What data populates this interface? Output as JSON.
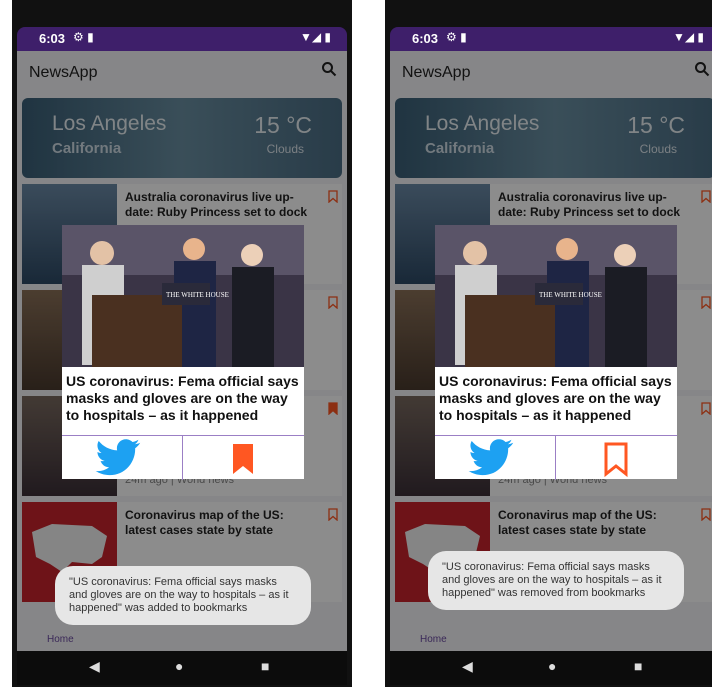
{
  "status": {
    "time": "6:03"
  },
  "app": {
    "title": "NewsApp"
  },
  "weather": {
    "city": "Los Angeles",
    "region": "California",
    "temp": "15 °C",
    "condition": "Clouds"
  },
  "articles": [
    {
      "headline": "Australia coronavirus live up-date: Ruby Princess set to dock",
      "meta": ""
    },
    {
      "headline": "",
      "meta": ""
    },
    {
      "headline": "",
      "meta": "24m ago | World news"
    },
    {
      "headline": "Coronavirus map of the US: latest cases state by state",
      "meta": ""
    }
  ],
  "dialog": {
    "title": "US coronavirus: Fema official says masks and gloves are on the way to hospitals – as it happened",
    "sign_text": "THE WHITE HOUSE"
  },
  "toast_added": "\"US coronavirus: Fema official says masks and gloves are on the way to hospitals – as it happened\" was added to bookmarks",
  "toast_removed": "\"US coronavirus: Fema official says masks and gloves are on the way to hospitals – as it happened\" was removed from bookmarks",
  "bottomnav": {
    "home_label": "Home"
  },
  "colors": {
    "accent": "#3e1f6a",
    "bookmark": "#ff5722",
    "twitter": "#1da1f2"
  }
}
